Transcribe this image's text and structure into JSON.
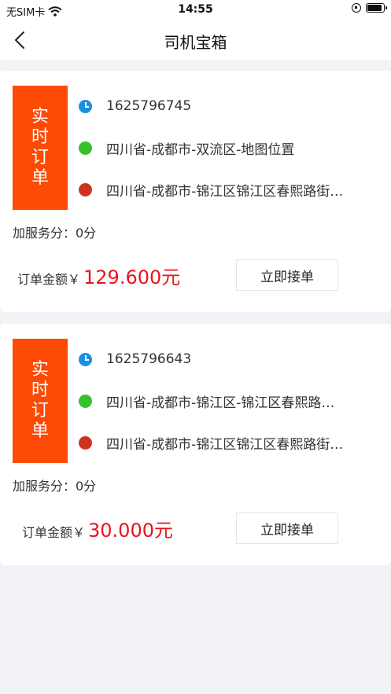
{
  "status_bar": {
    "carrier": "无SIM卡",
    "time": "14:55"
  },
  "header": {
    "title": "司机宝箱"
  },
  "orders": [
    {
      "badge": [
        "实",
        "时",
        "订",
        "单"
      ],
      "order_id": "1625796745",
      "start": "四川省-成都市-双流区-地图位置",
      "end": "四川省-成都市-锦江区锦江区春熙路街…",
      "extra": "加服务分：0分",
      "amount_label": "订单金额￥",
      "amount": "129.600元",
      "accept_label": "立即接单"
    },
    {
      "badge": [
        "实",
        "时",
        "订",
        "单"
      ],
      "order_id": "1625796643",
      "start": "四川省-成都市-锦江区-锦江区春熙路…",
      "end": "四川省-成都市-锦江区锦江区春熙路街…",
      "extra": "加服务分：0分",
      "amount_label": "订单金额￥",
      "amount": "30.000元",
      "accept_label": "立即接单"
    }
  ],
  "colors": {
    "badge": "#fd4a04",
    "amount": "#e8141a",
    "start_dot": "#34c12b",
    "end_dot": "#cf3320",
    "clock": "#1a90e0"
  },
  "icons": {
    "back": "back-arrow-icon",
    "wifi": "wifi-icon",
    "battery": "battery-icon",
    "orientation_lock": "orientation-lock-icon",
    "clock": "clock-icon"
  }
}
